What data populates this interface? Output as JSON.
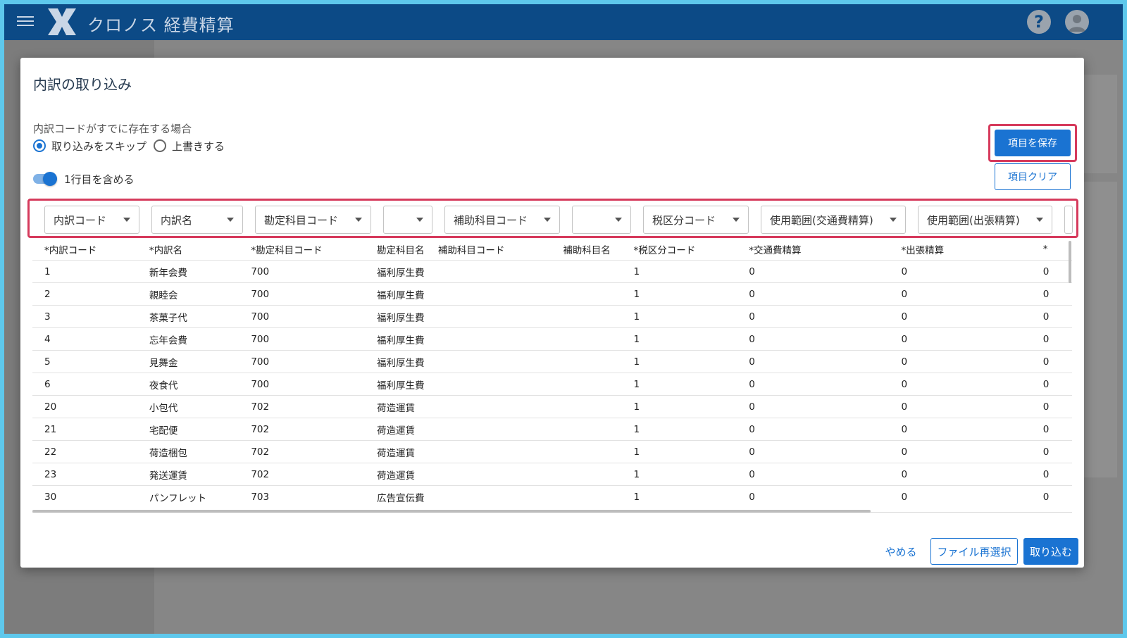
{
  "app": {
    "title": "クロノス 経費精算"
  },
  "dialog": {
    "title": "内訳の取り込み",
    "exists_label": "内訳コードがすでに存在する場合",
    "radio_skip": "取り込みをスキップ",
    "radio_overwrite": "上書きする",
    "selected_radio": "取り込みをスキップ",
    "toggle_label": "1行目を含める",
    "toggle_on": true,
    "save_label": "項目を保存",
    "clear_label": "項目クリア",
    "cancel_label": "やめる",
    "reselect_label": "ファイル再選択",
    "import_label": "取り込む"
  },
  "mapping": [
    "内訳コード",
    "内訳名",
    "勘定科目コード",
    "",
    "補助科目コード",
    "",
    "税区分コード",
    "使用範囲(交通費精算)",
    "使用範囲(出張精算)"
  ],
  "table": {
    "headers": [
      "*内訳コード",
      "*内訳名",
      "*勘定科目コード",
      "勘定科目名",
      "補助科目コード",
      "補助科目名",
      "*税区分コード",
      "*交通費精算",
      "*出張精算",
      "*"
    ],
    "rows": [
      [
        "1",
        "新年会費",
        "700",
        "福利厚生費",
        "",
        "",
        "1",
        "0",
        "0",
        "0"
      ],
      [
        "2",
        "親睦会",
        "700",
        "福利厚生費",
        "",
        "",
        "1",
        "0",
        "0",
        "0"
      ],
      [
        "3",
        "茶菓子代",
        "700",
        "福利厚生費",
        "",
        "",
        "1",
        "0",
        "0",
        "0"
      ],
      [
        "4",
        "忘年会費",
        "700",
        "福利厚生費",
        "",
        "",
        "1",
        "0",
        "0",
        "0"
      ],
      [
        "5",
        "見舞金",
        "700",
        "福利厚生費",
        "",
        "",
        "1",
        "0",
        "0",
        "0"
      ],
      [
        "6",
        "夜食代",
        "700",
        "福利厚生費",
        "",
        "",
        "1",
        "0",
        "0",
        "0"
      ],
      [
        "20",
        "小包代",
        "702",
        "荷造運賃",
        "",
        "",
        "1",
        "0",
        "0",
        "0"
      ],
      [
        "21",
        "宅配便",
        "702",
        "荷造運賃",
        "",
        "",
        "1",
        "0",
        "0",
        "0"
      ],
      [
        "22",
        "荷造梱包",
        "702",
        "荷造運賃",
        "",
        "",
        "1",
        "0",
        "0",
        "0"
      ],
      [
        "23",
        "発送運賃",
        "702",
        "荷造運賃",
        "",
        "",
        "1",
        "0",
        "0",
        "0"
      ],
      [
        "30",
        "パンフレット",
        "703",
        "広告宣伝費",
        "",
        "",
        "1",
        "0",
        "0",
        "0"
      ]
    ]
  },
  "colors": {
    "appbar": "#0c4a86",
    "accent": "#1a73d2",
    "highlight": "#d63a5c"
  }
}
